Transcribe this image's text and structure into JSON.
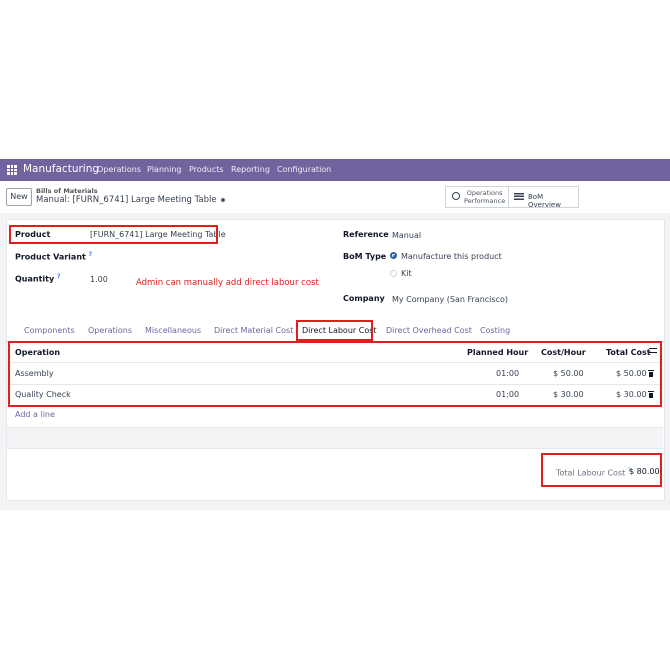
{
  "topbar": {
    "app_name": "Manufacturing",
    "menu": [
      "Operations",
      "Planning",
      "Products",
      "Reporting",
      "Configuration"
    ]
  },
  "control": {
    "new_label": "New",
    "breadcrumb_parent": "Bills of Materials",
    "breadcrumb_current": "Manual: [FURN_6741] Large Meeting Table",
    "operations_performance": [
      "Operations",
      "Performance"
    ],
    "bom_overview": "BoM Overview"
  },
  "form": {
    "product_label": "Product",
    "product_value": "[FURN_6741] Large Meeting Table",
    "variant_label": "Product Variant",
    "quantity_label": "Quantity",
    "quantity_value": "1.00",
    "help_mark": "?",
    "reference_label": "Reference",
    "reference_value": "Manual",
    "bom_type_label": "BoM Type",
    "bom_type_options": [
      "Manufacture this product",
      "Kit"
    ],
    "company_label": "Company",
    "company_value": "My Company (San Francisco)"
  },
  "annotation": "Admin can manually add direct labour cost",
  "tabs": [
    "Components",
    "Operations",
    "Miscellaneous",
    "Direct Material Cost",
    "Direct Labour Cost",
    "Direct Overhead Cost",
    "Costing"
  ],
  "active_tab": "Direct Labour Cost",
  "table": {
    "headers": [
      "Operation",
      "Planned Hour",
      "Cost/Hour",
      "Total Cost"
    ],
    "rows": [
      {
        "operation": "Assembly",
        "planned_hour": "01:00",
        "cost_hour": "$ 50.00",
        "total_cost": "$ 50.00"
      },
      {
        "operation": "Quality Check",
        "planned_hour": "01:00",
        "cost_hour": "$ 30.00",
        "total_cost": "$ 30.00"
      }
    ],
    "add_line": "Add a line"
  },
  "totals": {
    "label": "Total Labour Cost",
    "value": "$ 80.00"
  },
  "colors": {
    "brand": "#71639e",
    "annotation_red": "#e11d1d",
    "radio_blue": "#2f5fa7"
  }
}
